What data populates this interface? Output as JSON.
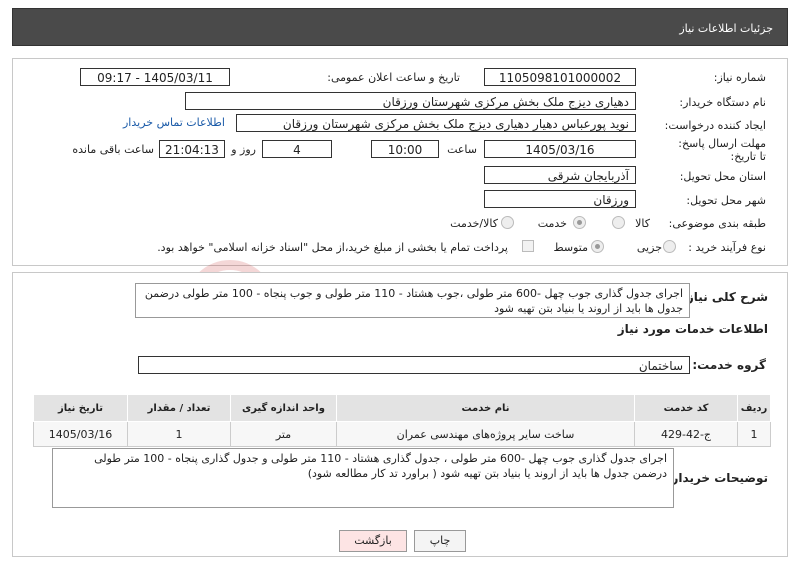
{
  "header": {
    "title": "جزئیات اطلاعات نیاز"
  },
  "form": {
    "need_number_label": "شماره نیاز:",
    "need_number": "1105098101000002",
    "announce_label": "تاریخ و ساعت اعلان عمومی:",
    "announce_value": "1405/03/11 - 09:17",
    "buyer_org_label": "نام دستگاه خریدار:",
    "buyer_org": "دهیاری دیزج ملک بخش مرکزی شهرستان ورزقان",
    "requester_label": "ایجاد کننده درخواست:",
    "requester": "نوید پورعباس دهیار دهیاری دیزج ملک بخش مرکزی شهرستان ورزقان",
    "contact_link": "اطلاعات تماس خریدار",
    "deadline_label": "مهلت ارسال پاسخ: تا تاریخ:",
    "deadline_date": "1405/03/16",
    "time_label": "ساعت",
    "deadline_time": "10:00",
    "days_value": "4",
    "days_label": "روز و",
    "remaining_time": "21:04:13",
    "remaining_label": "ساعت باقی مانده",
    "province_label": "استان محل تحویل:",
    "province": "آذربایجان شرقی",
    "city_label": "شهر محل تحویل:",
    "city": "ورزقان",
    "category_label": "طبقه بندی موضوعی:",
    "category_options": [
      "کالا",
      "خدمت",
      "کالا/خدمت"
    ],
    "category_selected": "خدمت",
    "process_label": "نوع فرآیند خرید :",
    "process_options": [
      "جزیی",
      "متوسط"
    ],
    "process_selected": "متوسط",
    "payment_note": "پرداخت تمام یا بخشی از مبلغ خرید،از محل \"اسناد خزانه اسلامی\" خواهد بود."
  },
  "summary": {
    "label": "شرح کلی نیاز:",
    "text": "اجرای جدول گذاری جوب چهل -600 متر طولی ،جوب هشتاد - 110 متر طولی و جوب پنجاه - 100 متر طولی درضمن جدول ها باید از اروند یا بنیاد بتن تهیه شود"
  },
  "services": {
    "section_title": "اطلاعات خدمات مورد نیاز",
    "group_label": "گروه خدمت:",
    "group_value": "ساختمان",
    "columns": [
      "ردیف",
      "کد خدمت",
      "نام خدمت",
      "واحد اندازه گیری",
      "تعداد / مقدار",
      "تاریخ نیاز"
    ],
    "rows": [
      {
        "row": "1",
        "code": "ج-42-429",
        "name": "ساخت سایر پروژه‌های مهندسی عمران",
        "unit": "متر",
        "qty": "1",
        "date": "1405/03/16"
      }
    ]
  },
  "buyer_notes": {
    "label": "توضیحات خریدار:",
    "text": "اجرای جدول گذاری جوب چهل -600 متر طولی ، جدول گذاری هشتاد - 110 متر طولی و جدول گذاری پنجاه - 100 متر طولی درضمن جدول ها باید از اروند یا بنیاد بتن تهیه شود ( براورد تد کار مطالعه شود)"
  },
  "buttons": {
    "print": "چاپ",
    "back": "بازگشت"
  },
  "colors": {
    "header_bg": "#4a4a4a",
    "back_bg": "#fde4e4",
    "link": "#1a5aa8",
    "watermark": "#c62828"
  }
}
